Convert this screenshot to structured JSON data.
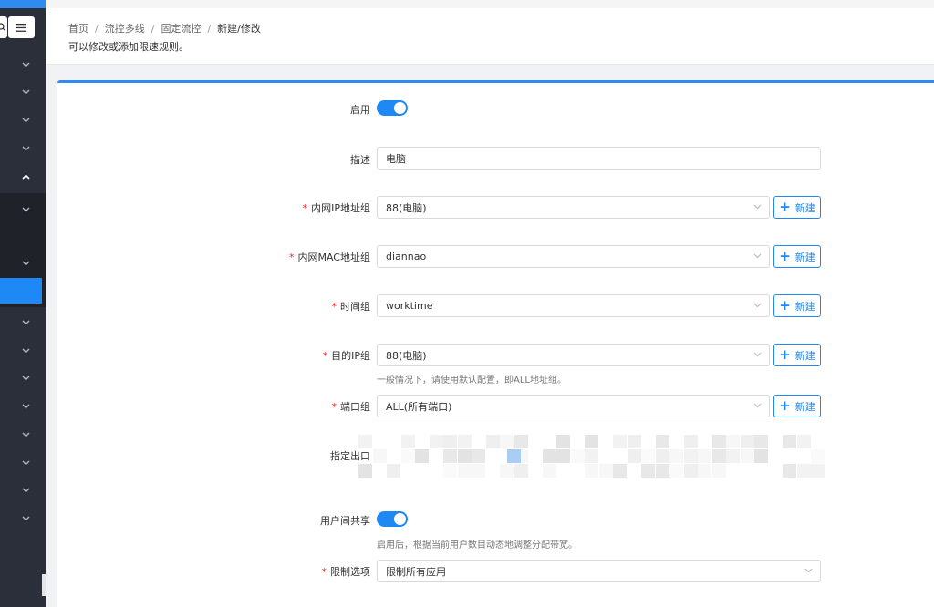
{
  "breadcrumb": {
    "items": [
      "首页",
      "流控多线",
      "固定流控",
      "新建/修改"
    ]
  },
  "page": {
    "description": "可以修改或添加限速规则。"
  },
  "form": {
    "enable": {
      "label": "启用",
      "on": true
    },
    "desc": {
      "label": "描述",
      "value": "电脑"
    },
    "ip_group": {
      "label": "内网IP地址组",
      "value": "88(电脑)",
      "new_label": "新建"
    },
    "mac_group": {
      "label": "内网MAC地址组",
      "value": "diannao",
      "new_label": "新建"
    },
    "time_group": {
      "label": "时间组",
      "value": "worktime",
      "new_label": "新建"
    },
    "dest_ip_group": {
      "label": "目的IP组",
      "value": "88(电脑)",
      "new_label": "新建",
      "hint": "一般情况下，请使用默认配置，即ALL地址组。"
    },
    "port_group": {
      "label": "端口组",
      "value": "ALL(所有端口)",
      "new_label": "新建"
    },
    "outlet": {
      "label": "指定出口"
    },
    "share": {
      "label": "用户间共享",
      "on": true,
      "hint": "启用后，根据当前用户数目动态地调整分配带宽。"
    },
    "limit": {
      "label": "限制选项",
      "value": "限制所有应用"
    }
  },
  "colors": {
    "accent": "#1e88f5",
    "sidebar": "#2b2f3a",
    "required": "#f5222d"
  },
  "icons": {
    "search": "search-icon",
    "menu": "hamburger-icon",
    "chevron_down": "chevron-down-icon",
    "chevron_up": "chevron-up-icon",
    "plus": "plus-icon"
  }
}
